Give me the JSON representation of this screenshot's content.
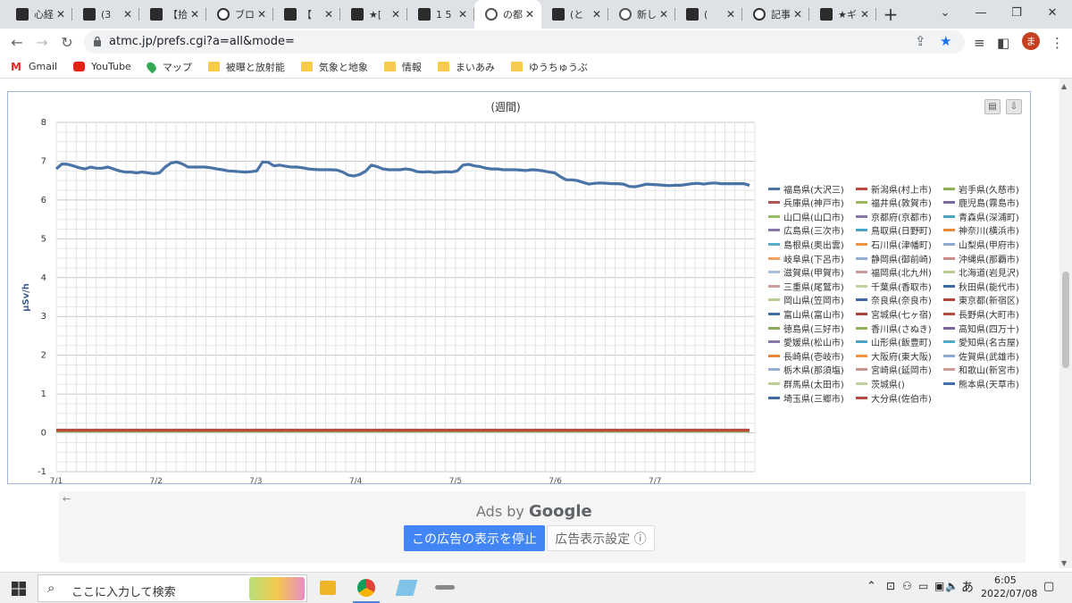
{
  "browser": {
    "tabs": [
      {
        "title": "心経",
        "active": false,
        "icon": "site-icon"
      },
      {
        "title": "(3",
        "active": false,
        "icon": "site-icon"
      },
      {
        "title": "【拾",
        "active": false,
        "icon": "site-icon"
      },
      {
        "title": "ブロ",
        "active": false,
        "icon": "info-icon"
      },
      {
        "title": "【",
        "active": false,
        "icon": "site-icon"
      },
      {
        "title": "★[",
        "active": false,
        "icon": "site-icon"
      },
      {
        "title": "1 5",
        "active": false,
        "icon": "site-icon"
      },
      {
        "title": "の都",
        "active": true,
        "icon": "globe-icon"
      },
      {
        "title": "(と",
        "active": false,
        "icon": "site-icon"
      },
      {
        "title": "新し",
        "active": false,
        "icon": "chrome-icon"
      },
      {
        "title": "(",
        "active": false,
        "icon": "site-icon"
      },
      {
        "title": "記事",
        "active": false,
        "icon": "info-icon"
      },
      {
        "title": "★ギ",
        "active": false,
        "icon": "site-icon"
      }
    ],
    "new_tab": "+",
    "url": "atmc.jp/prefs.cgi?a=all&mode=",
    "avatar_letter": "ま",
    "bookmarks": [
      {
        "label": "Gmail",
        "icon": "gmail-icon"
      },
      {
        "label": "YouTube",
        "icon": "youtube-icon"
      },
      {
        "label": "マップ",
        "icon": "maps-icon"
      },
      {
        "label": "被曝と放射能",
        "icon": "folder-icon"
      },
      {
        "label": "気象と地象",
        "icon": "folder-icon"
      },
      {
        "label": "情報",
        "icon": "folder-icon"
      },
      {
        "label": "まいあみ",
        "icon": "folder-icon"
      },
      {
        "label": "ゆうちゅうぶ",
        "icon": "folder-icon"
      }
    ]
  },
  "chart_data": {
    "type": "line",
    "title": "(週間)",
    "ylabel": "μSv/h",
    "xlabel": "",
    "ylim": [
      -1,
      8
    ],
    "yticks": [
      "8",
      "7",
      "6",
      "5",
      "4",
      "3",
      "2",
      "1",
      "0",
      "-1"
    ],
    "x_labels": [
      "7/1",
      "7/2",
      "7/3",
      "7/4",
      "7/5",
      "7/6",
      "7/7"
    ],
    "grid": true,
    "legend_position": "right",
    "series": [
      {
        "name": "福島県(大沢三)",
        "color": "#4a73a8",
        "values": [
          6.8,
          6.93,
          6.92,
          6.88,
          6.83,
          6.8,
          6.85,
          6.82,
          6.82,
          6.85,
          6.8,
          6.75,
          6.72,
          6.72,
          6.7,
          6.72,
          6.7,
          6.68,
          6.7,
          6.85,
          6.95,
          6.98,
          6.93,
          6.85,
          6.85,
          6.85,
          6.85,
          6.83,
          6.8,
          6.78,
          6.75,
          6.74,
          6.73,
          6.72,
          6.73,
          6.75,
          6.98,
          6.97,
          6.88,
          6.9,
          6.87,
          6.85,
          6.85,
          6.83,
          6.8,
          6.79,
          6.78,
          6.78,
          6.78,
          6.77,
          6.72,
          6.64,
          6.62,
          6.66,
          6.74,
          6.9,
          6.86,
          6.8,
          6.78,
          6.78,
          6.78,
          6.8,
          6.78,
          6.73,
          6.72,
          6.73,
          6.71,
          6.72,
          6.73,
          6.72,
          6.75,
          6.9,
          6.92,
          6.88,
          6.86,
          6.82,
          6.8,
          6.8,
          6.78,
          6.78,
          6.78,
          6.77,
          6.76,
          6.78,
          6.77,
          6.75,
          6.72,
          6.7,
          6.6,
          6.52,
          6.52,
          6.5,
          6.45,
          6.41,
          6.43,
          6.44,
          6.43,
          6.42,
          6.42,
          6.41,
          6.35,
          6.34,
          6.37,
          6.41,
          6.4,
          6.39,
          6.38,
          6.37,
          6.38,
          6.38,
          6.4,
          6.42,
          6.43,
          6.41,
          6.43,
          6.44,
          6.42,
          6.42,
          6.42,
          6.42,
          6.42,
          6.38
        ]
      },
      {
        "name": "新潟県(村上市)",
        "color": "#b94a3f",
        "values": [
          0.07,
          0.07
        ]
      },
      {
        "name": "岩手県(久慈市)",
        "color": "#8db052",
        "values": [
          0.05,
          0.05
        ]
      },
      {
        "name": "兵庫県(神戸市)",
        "color": "#b35252",
        "values": [
          0.06,
          0.06
        ]
      },
      {
        "name": "福井県(敦賀市)",
        "color": "#9ab85c",
        "values": [
          0.05,
          0.05
        ]
      },
      {
        "name": "鹿児島(霧島市)",
        "color": "#7c6ba3",
        "values": [
          0.06,
          0.06
        ]
      },
      {
        "name": "山口県(山口市)",
        "color": "#98bc62",
        "values": [
          0.06,
          0.06
        ]
      },
      {
        "name": "京都府(京都市)",
        "color": "#8a74aa",
        "values": [
          0.06,
          0.06
        ]
      },
      {
        "name": "青森県(深浦町)",
        "color": "#4aa5c0",
        "values": [
          0.05,
          0.05
        ]
      },
      {
        "name": "広島県(三次市)",
        "color": "#8877ad",
        "values": [
          0.05,
          0.05
        ]
      },
      {
        "name": "鳥取県(日野町)",
        "color": "#4aa7c4",
        "values": [
          0.06,
          0.06
        ]
      },
      {
        "name": "神奈川(横浜市)",
        "color": "#e38a3a",
        "values": [
          0.05,
          0.05
        ]
      },
      {
        "name": "島根県(奥出雲)",
        "color": "#55aec8",
        "values": [
          0.06,
          0.06
        ]
      },
      {
        "name": "石川県(津幡町)",
        "color": "#ef9544",
        "values": [
          0.06,
          0.06
        ]
      },
      {
        "name": "山梨県(甲府市)",
        "color": "#8da9d0",
        "values": [
          0.05,
          0.05
        ]
      },
      {
        "name": "岐阜県(下呂市)",
        "color": "#f2a25c",
        "values": [
          0.06,
          0.06
        ]
      },
      {
        "name": "静岡県(御前崎)",
        "color": "#93add3",
        "values": [
          0.05,
          0.05
        ]
      },
      {
        "name": "沖縄県(那覇市)",
        "color": "#c98c8a",
        "values": [
          0.05,
          0.05
        ]
      },
      {
        "name": "滋賀県(甲賀市)",
        "color": "#a9bfe0",
        "values": [
          0.06,
          0.06
        ]
      },
      {
        "name": "福岡県(北九州)",
        "color": "#c99a98",
        "values": [
          0.05,
          0.05
        ]
      },
      {
        "name": "北海道(岩見沢)",
        "color": "#b9cc8f",
        "values": [
          0.05,
          0.05
        ]
      },
      {
        "name": "三重県(尾鷲市)",
        "color": "#cf9e9d",
        "values": [
          0.06,
          0.06
        ]
      },
      {
        "name": "千葉県(香取市)",
        "color": "#c1d39c",
        "values": [
          0.06,
          0.06
        ]
      },
      {
        "name": "秋田県(能代市)",
        "color": "#3c6aa6",
        "values": [
          0.06,
          0.06
        ]
      },
      {
        "name": "岡山県(笠岡市)",
        "color": "#b8cc92",
        "values": [
          0.05,
          0.05
        ]
      },
      {
        "name": "奈良県(奈良市)",
        "color": "#4169a0",
        "values": [
          0.05,
          0.05
        ]
      },
      {
        "name": "東京都(新宿区)",
        "color": "#b2453c",
        "values": [
          0.06,
          0.06
        ]
      },
      {
        "name": "富山県(富山市)",
        "color": "#3f6fa8",
        "values": [
          0.05,
          0.05
        ]
      },
      {
        "name": "宮城県(七ヶ宿)",
        "color": "#a8433c",
        "values": [
          0.06,
          0.06
        ]
      },
      {
        "name": "長野県(大町市)",
        "color": "#b24b42",
        "values": [
          0.05,
          0.05
        ]
      },
      {
        "name": "徳島県(三好市)",
        "color": "#8bad55",
        "values": [
          0.05,
          0.05
        ]
      },
      {
        "name": "香川県(さぬき)",
        "color": "#90b25b",
        "values": [
          0.06,
          0.06
        ]
      },
      {
        "name": "高知県(四万十)",
        "color": "#7d66a0",
        "values": [
          0.05,
          0.05
        ]
      },
      {
        "name": "愛媛県(松山市)",
        "color": "#8b78ad",
        "values": [
          0.05,
          0.05
        ]
      },
      {
        "name": "山形県(飯豊町)",
        "color": "#4aa6c2",
        "values": [
          0.05,
          0.05
        ]
      },
      {
        "name": "愛知県(名古屋)",
        "color": "#4eaac6",
        "values": [
          0.06,
          0.06
        ]
      },
      {
        "name": "長崎県(壱岐市)",
        "color": "#e8883b",
        "values": [
          0.06,
          0.06
        ]
      },
      {
        "name": "大阪府(東大阪)",
        "color": "#ef9244",
        "values": [
          0.05,
          0.05
        ]
      },
      {
        "name": "佐賀県(武雄市)",
        "color": "#8ea8d0",
        "values": [
          0.05,
          0.05
        ]
      },
      {
        "name": "栃木県(那須塩)",
        "color": "#94aed4",
        "values": [
          0.05,
          0.05
        ]
      },
      {
        "name": "宮崎県(延岡市)",
        "color": "#c89592",
        "values": [
          0.06,
          0.06
        ]
      },
      {
        "name": "和歌山(新宮市)",
        "color": "#cf9c98",
        "values": [
          0.05,
          0.05
        ]
      },
      {
        "name": "群馬県(太田市)",
        "color": "#bcd096",
        "values": [
          0.06,
          0.06
        ]
      },
      {
        "name": "茨城県()",
        "color": "#c0d29c",
        "values": [
          0.05,
          0.05
        ]
      },
      {
        "name": "熊本県(天草市)",
        "color": "#4070aa",
        "values": [
          0.05,
          0.05
        ]
      },
      {
        "name": "埼玉県(三郷市)",
        "color": "#3d68a0",
        "values": [
          0.05,
          0.05
        ]
      },
      {
        "name": "大分県(佐伯市)",
        "color": "#b24a40",
        "values": [
          0.06,
          0.06
        ]
      }
    ]
  },
  "chart_tools": {
    "print_icon": "printer-icon",
    "download_icon": "download-icon"
  },
  "ad": {
    "back": "←",
    "ads_by": "Ads by",
    "google": "Google",
    "stop": "この広告の表示を停止",
    "settings": "広告表示設定 ⓘ"
  },
  "taskbar": {
    "search_placeholder": "ここに入力して検索",
    "ime": "あ",
    "time": "6:05",
    "date": "2022/07/08"
  }
}
